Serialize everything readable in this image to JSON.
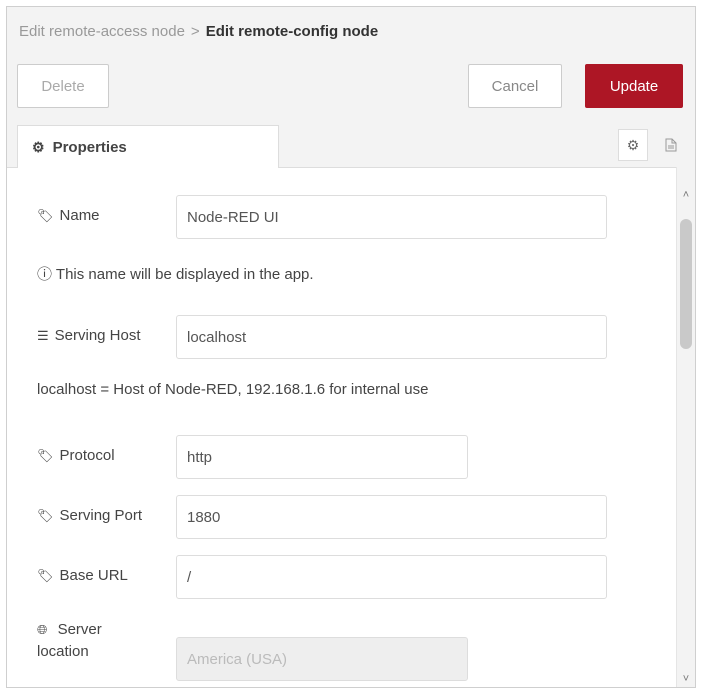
{
  "header": {
    "breadcrumb_prev": "Edit remote-access node",
    "breadcrumb_sep": ">",
    "breadcrumb_current": "Edit remote-config node"
  },
  "toolbar": {
    "delete_label": "Delete",
    "cancel_label": "Cancel",
    "update_label": "Update"
  },
  "tabs": {
    "properties_label": "Properties"
  },
  "form": {
    "name": {
      "label": "Name",
      "value": "Node-RED UI"
    },
    "name_hint": "This name will be displayed in the app.",
    "serving_host": {
      "label": "Serving Host",
      "value": "localhost"
    },
    "host_hint": "localhost = Host of Node-RED, 192.168.1.6 for internal use",
    "protocol": {
      "label": "Protocol",
      "value": "http"
    },
    "serving_port": {
      "label": "Serving Port",
      "value": "1880"
    },
    "base_url": {
      "label": "Base URL",
      "value": "/"
    },
    "server_location": {
      "label_line1": "Server",
      "label_line2": "location",
      "value": "America (USA)"
    }
  },
  "colors": {
    "accent": "#ad1625",
    "panel_bg": "#f3f3f3"
  },
  "icons": {
    "tag": "tag-icon",
    "info": "info-circle-icon",
    "list": "list-icon",
    "globe": "globe-icon",
    "gear": "gear-icon",
    "doc": "document-icon"
  }
}
